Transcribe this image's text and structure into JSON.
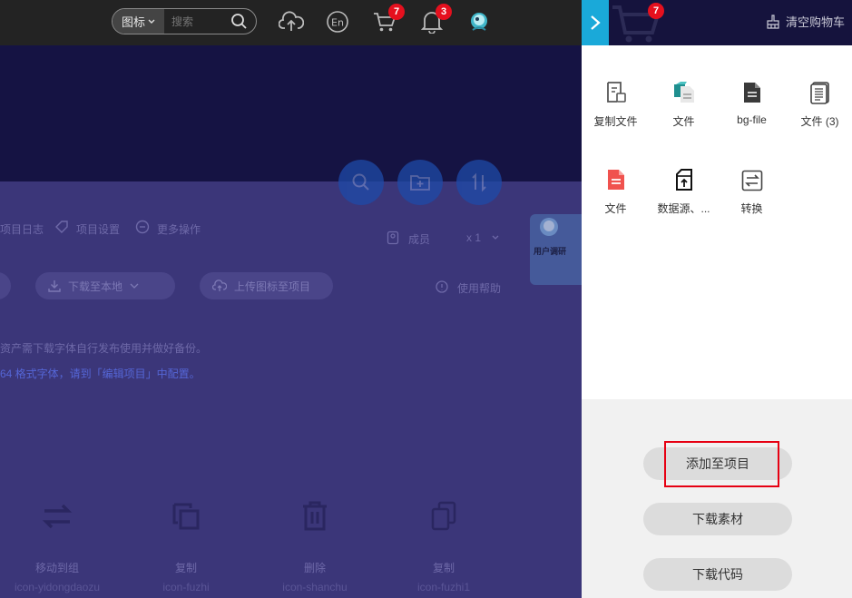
{
  "topbar": {
    "search_type": "图标",
    "search_placeholder": "搜索",
    "cart_count": "7",
    "notice_count": "3"
  },
  "toolbar": {
    "log": "项目日志",
    "settings": "项目设置",
    "more": "更多操作",
    "members": "成员",
    "member_count": "x 1",
    "download_local": "下载至本地",
    "upload_icon": "上传图标至项目",
    "help": "使用帮助"
  },
  "notes": {
    "line1": "资产需下载字体自行发布使用并做好备份。",
    "line2": "64 格式字体，请到「编辑项目」中配置。"
  },
  "promo": {
    "text": "用户调研"
  },
  "icon_ops": [
    {
      "label": "移动到组",
      "code": "icon-yidongdaozu"
    },
    {
      "label": "复制",
      "code": "icon-fuzhi"
    },
    {
      "label": "删除",
      "code": "icon-shanchu"
    },
    {
      "label": "复制",
      "code": "icon-fuzhi1"
    }
  ],
  "cart": {
    "count": "7",
    "clear_label": "清空购物车",
    "items": [
      {
        "name": "复制文件",
        "icon": "copy-file-icon"
      },
      {
        "name": "文件",
        "icon": "file-teal-icon"
      },
      {
        "name": "bg-file",
        "icon": "bg-file-icon"
      },
      {
        "name": "文件 (3)",
        "icon": "file-lines-icon"
      },
      {
        "name": "文件",
        "icon": "file-red-icon"
      },
      {
        "name": "数据源、...",
        "icon": "datasource-icon"
      },
      {
        "name": "转换",
        "icon": "convert-icon"
      }
    ],
    "add_to_project": "添加至项目",
    "download_assets": "下载素材",
    "download_code": "下载代码"
  },
  "colors": {
    "accent": "#1aa9d9",
    "badge": "#e5101e",
    "highlight": "#e60012",
    "overlay": "#3b3679"
  }
}
